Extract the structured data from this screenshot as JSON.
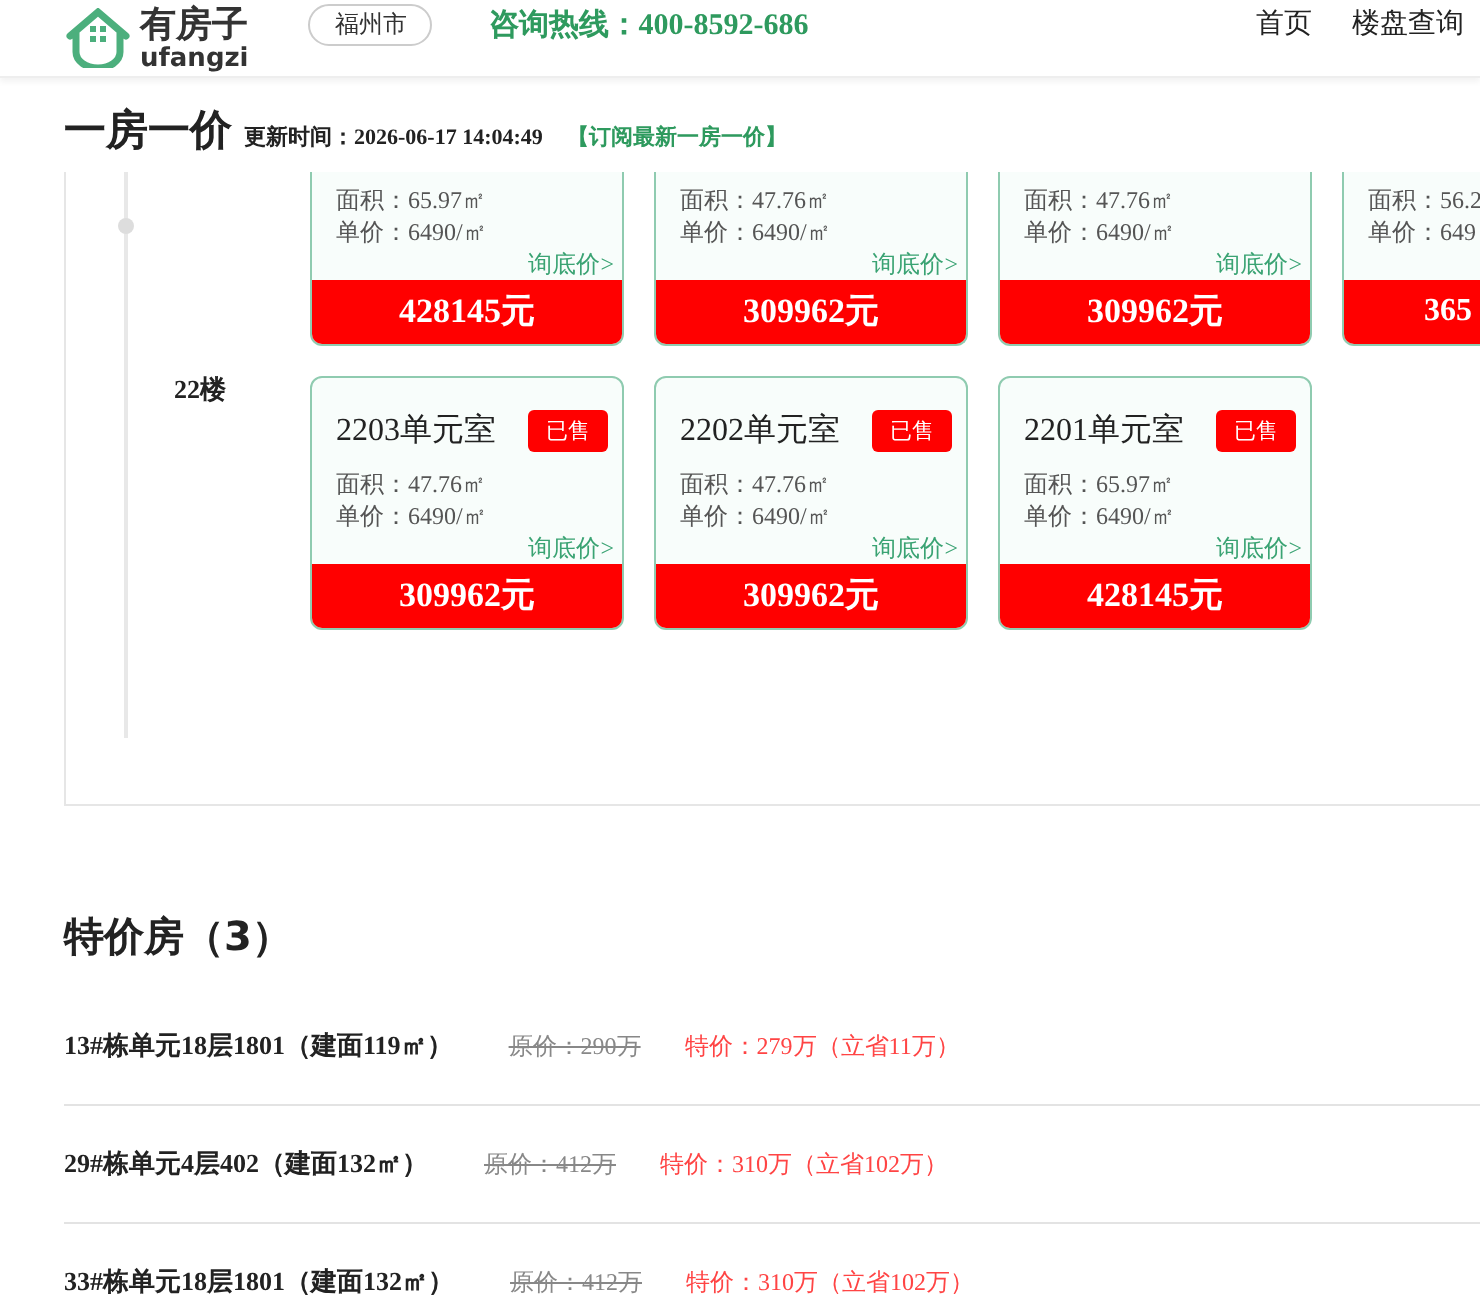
{
  "header": {
    "logo_text": "有房子",
    "logo_sub": "ufangzi",
    "city": "福州市",
    "hotline": "咨询热线：400-8592-686",
    "nav": [
      {
        "label": "首页"
      },
      {
        "label": "楼盘查询"
      }
    ]
  },
  "one_price": {
    "title": "一房一价",
    "updated": "更新时间：2026-06-17 14:04:49",
    "subscribe": "【订阅最新一房一价】",
    "floors": [
      {
        "units": [
          {
            "area": "面积：65.97㎡",
            "unit_price": "单价：6490/㎡",
            "inquiry": "询底价>",
            "total": "428145元"
          },
          {
            "area": "面积：47.76㎡",
            "unit_price": "单价：6490/㎡",
            "inquiry": "询底价>",
            "total": "309962元"
          },
          {
            "area": "面积：47.76㎡",
            "unit_price": "单价：6490/㎡",
            "inquiry": "询底价>",
            "total": "309962元"
          },
          {
            "area": "面积：56.2",
            "unit_price": "单价：649",
            "total": "365"
          }
        ]
      },
      {
        "floor": "22楼",
        "units": [
          {
            "room": "2203单元室",
            "status": "已售",
            "area": "面积：47.76㎡",
            "unit_price": "单价：6490/㎡",
            "inquiry": "询底价>",
            "total": "309962元"
          },
          {
            "room": "2202单元室",
            "status": "已售",
            "area": "面积：47.76㎡",
            "unit_price": "单价：6490/㎡",
            "inquiry": "询底价>",
            "total": "309962元"
          },
          {
            "room": "2201单元室",
            "status": "已售",
            "area": "面积：65.97㎡",
            "unit_price": "单价：6490/㎡",
            "inquiry": "询底价>",
            "total": "428145元"
          }
        ]
      }
    ]
  },
  "specials": {
    "title": "特价房（3）",
    "rows": [
      {
        "name": "13#栋单元18层1801（建面119㎡）",
        "original": "原价：290万",
        "special": "特价：279万（立省11万）"
      },
      {
        "name": "29#栋单元4层402（建面132㎡）",
        "original": "原价：412万",
        "special": "特价：310万（立省102万）"
      },
      {
        "name": "33#栋单元18层1801（建面132㎡）",
        "original": "原价：412万",
        "special": "特价：310万（立省102万）"
      }
    ]
  }
}
